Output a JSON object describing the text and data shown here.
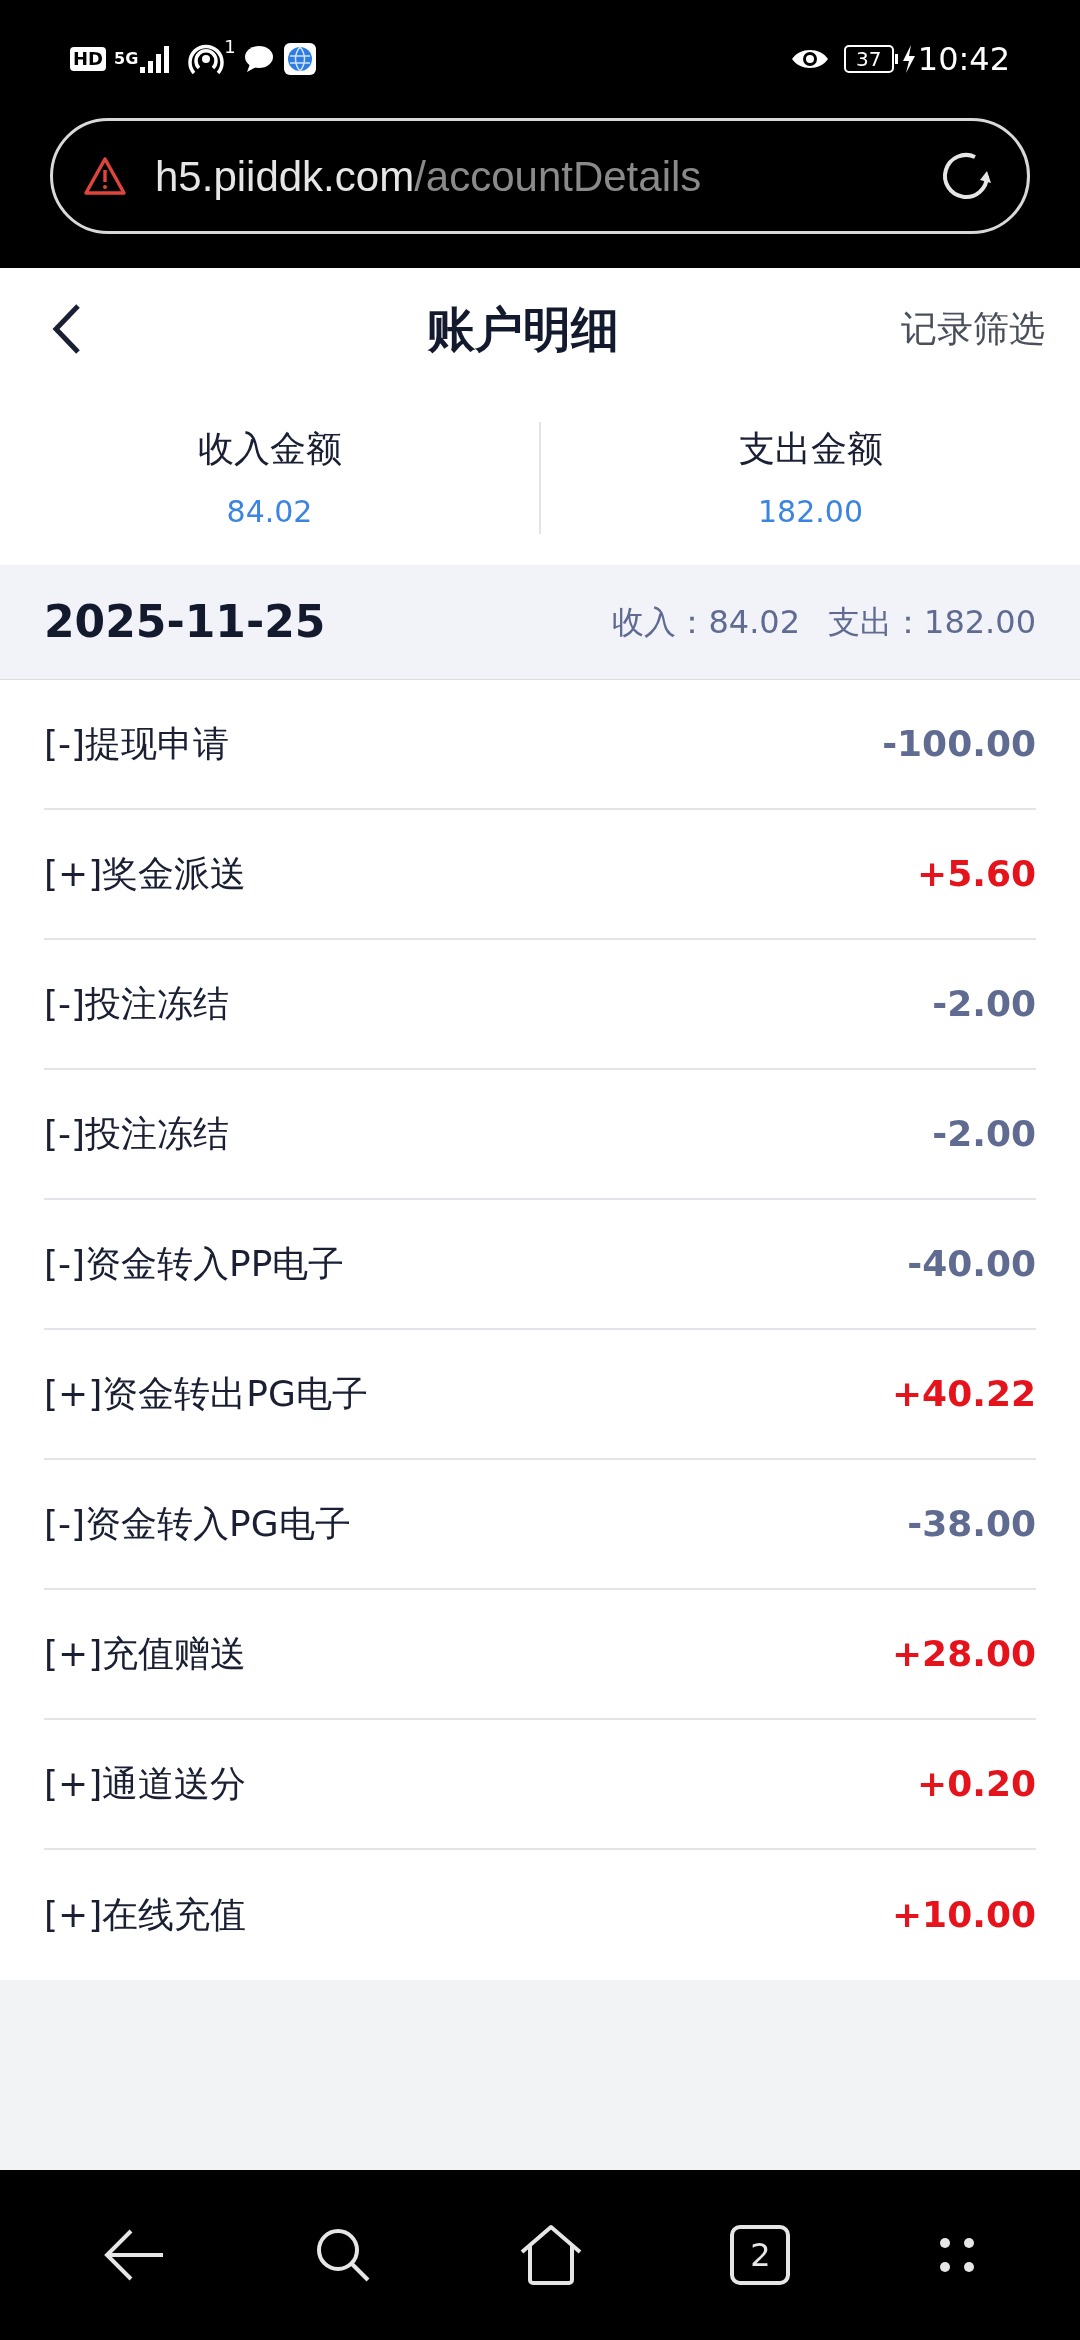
{
  "status_bar": {
    "hd": "HD",
    "network": "5G",
    "hotspot_count": "1",
    "battery": "37",
    "time": "10:42"
  },
  "address_bar": {
    "host": "h5.piiddk.com",
    "path": "/accountDetails"
  },
  "header": {
    "title": "账户明细",
    "action": "记录筛选"
  },
  "summary": [
    {
      "label": "收入金额",
      "value": "84.02"
    },
    {
      "label": "支出金额",
      "value": "182.00"
    }
  ],
  "date_group": {
    "date": "2025-11-25",
    "income_label": "收入：",
    "income": "84.02",
    "expense_label": "支出：",
    "expense": "182.00"
  },
  "records": [
    {
      "label": "[-]提现申请",
      "amount": "-100.00",
      "kind": "minus"
    },
    {
      "label": "[+]奖金派送",
      "amount": "+5.60",
      "kind": "plus"
    },
    {
      "label": "[-]投注冻结",
      "amount": "-2.00",
      "kind": "minus"
    },
    {
      "label": "[-]投注冻结",
      "amount": "-2.00",
      "kind": "minus"
    },
    {
      "label": "[-]资金转入PP电子",
      "amount": "-40.00",
      "kind": "minus"
    },
    {
      "label": "[+]资金转出PG电子",
      "amount": "+40.22",
      "kind": "plus"
    },
    {
      "label": "[-]资金转入PG电子",
      "amount": "-38.00",
      "kind": "minus"
    },
    {
      "label": "[+]充值赠送",
      "amount": "+28.00",
      "kind": "plus"
    },
    {
      "label": "[+]通道送分",
      "amount": "+0.20",
      "kind": "plus"
    },
    {
      "label": "[+]在线充值",
      "amount": "+10.00",
      "kind": "plus"
    }
  ],
  "nav_bar": {
    "tab_count": "2"
  }
}
